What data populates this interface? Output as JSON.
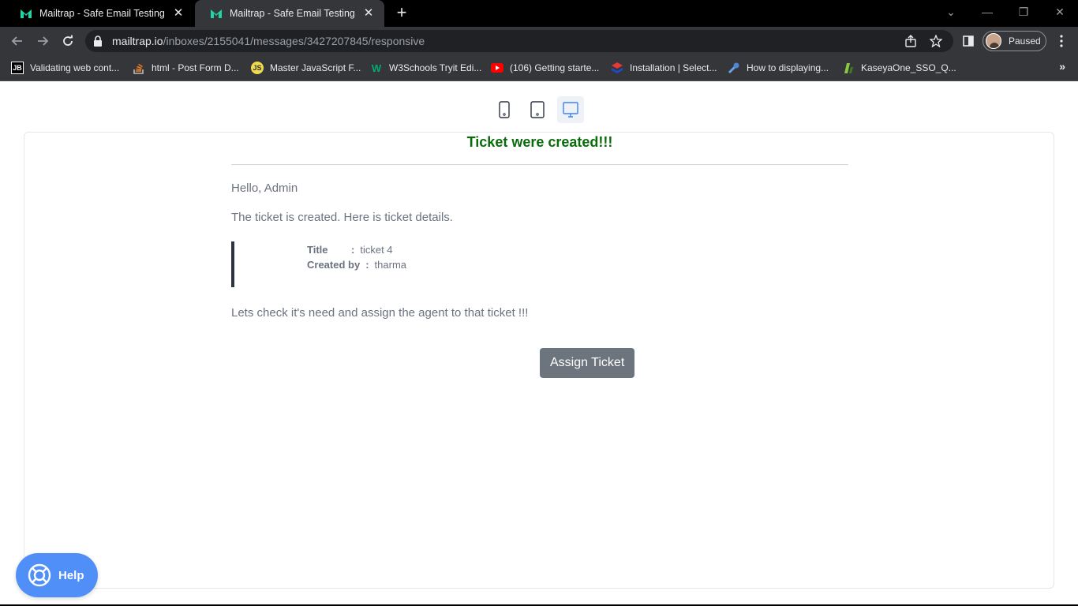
{
  "browser": {
    "tabs": [
      {
        "title": "Mailtrap - Safe Email Testing",
        "active": false
      },
      {
        "title": "Mailtrap - Safe Email Testing",
        "active": true
      }
    ],
    "url_host": "mailtrap.io",
    "url_path": "/inboxes/2155041/messages/3427207845/responsive",
    "profile_label": "Paused",
    "bookmarks": [
      {
        "label": "Validating web cont...",
        "icon": "jetbrains-icon"
      },
      {
        "label": "html - Post Form D...",
        "icon": "stackoverflow-icon"
      },
      {
        "label": "Master JavaScript F...",
        "icon": "js-icon"
      },
      {
        "label": "W3Schools Tryit Edi...",
        "icon": "w3schools-icon"
      },
      {
        "label": "(106) Getting starte...",
        "icon": "youtube-icon"
      },
      {
        "label": "Installation | Select...",
        "icon": "selectize-icon"
      },
      {
        "label": "How to displaying...",
        "icon": "wrench-icon"
      },
      {
        "label": "KaseyaOne_SSO_Q...",
        "icon": "kaseya-icon"
      }
    ]
  },
  "viewer": {
    "device_modes": [
      "mobile",
      "tablet",
      "desktop"
    ],
    "selected_mode": "desktop"
  },
  "email": {
    "heading": "Ticket were created!!!",
    "greeting": "Hello, Admin",
    "intro": "The ticket is created. Here is ticket details.",
    "details": [
      {
        "key": "Title",
        "sep": ":",
        "value": "ticket 4"
      },
      {
        "key": "Created by",
        "sep": ":",
        "value": "tharma"
      }
    ],
    "closing": "Lets check it's need and assign the agent to that ticket !!!",
    "button_label": "Assign Ticket"
  },
  "help": {
    "label": "Help"
  },
  "colors": {
    "heading": "#0a6b0a",
    "button": "#6c757d",
    "help": "#4f8ff7",
    "accent_desktop": "#3b82f6"
  }
}
